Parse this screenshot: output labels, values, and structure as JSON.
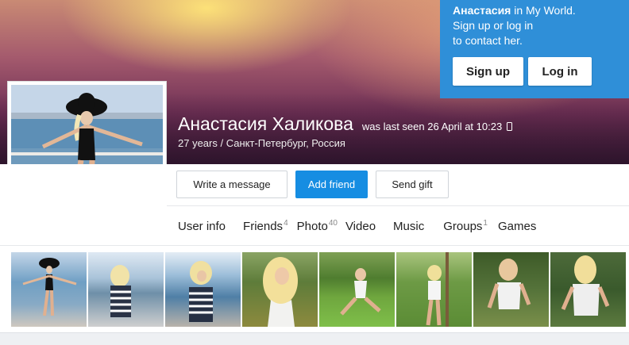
{
  "signup": {
    "name": "Анастасия",
    "line1_suffix": " in My World.",
    "line2": "Sign up or log in",
    "line3": "to contact her.",
    "signup_label": "Sign up",
    "login_label": "Log in"
  },
  "profile": {
    "name": "Анастасия Халикова",
    "last_seen": "was last seen 26 April at 10:23",
    "location": "27 years / Санкт-Петербург, Россия"
  },
  "actions": {
    "write_message": "Write a message",
    "add_friend": "Add friend",
    "send_gift": "Send gift"
  },
  "tabs": {
    "user_info": "User info",
    "friends": "Friends",
    "friends_count": "4",
    "photo": "Photo",
    "photo_count": "40",
    "video": "Video",
    "music": "Music",
    "groups": "Groups",
    "groups_count": "1",
    "games": "Games"
  },
  "colors": {
    "accent": "#2f8fd8",
    "button_primary": "#168de2"
  },
  "icons": {
    "last_seen_device": "phone-icon"
  }
}
